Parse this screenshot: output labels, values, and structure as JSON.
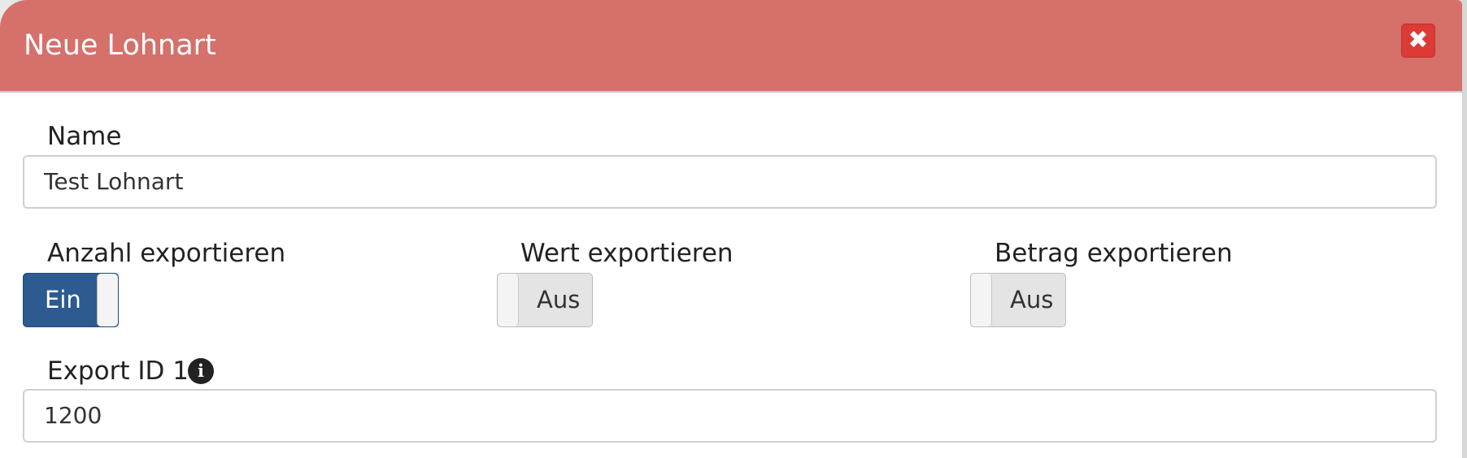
{
  "dialog": {
    "title": "Neue Lohnart",
    "close_icon": "close-icon",
    "header_color": "#d5706b",
    "close_color": "#dc3a35"
  },
  "form": {
    "name": {
      "label": "Name",
      "value": "Test Lohnart"
    },
    "toggles": [
      {
        "label": "Anzahl exportieren",
        "state": "Ein",
        "on": true
      },
      {
        "label": "Wert exportieren",
        "state": "Aus",
        "on": false
      },
      {
        "label": "Betrag exportieren",
        "state": "Aus",
        "on": false
      }
    ],
    "toggle_on_color": "#2d5a91",
    "export_id_1": {
      "label": "Export ID 1",
      "value": "1200",
      "info_icon": "info-icon"
    }
  }
}
